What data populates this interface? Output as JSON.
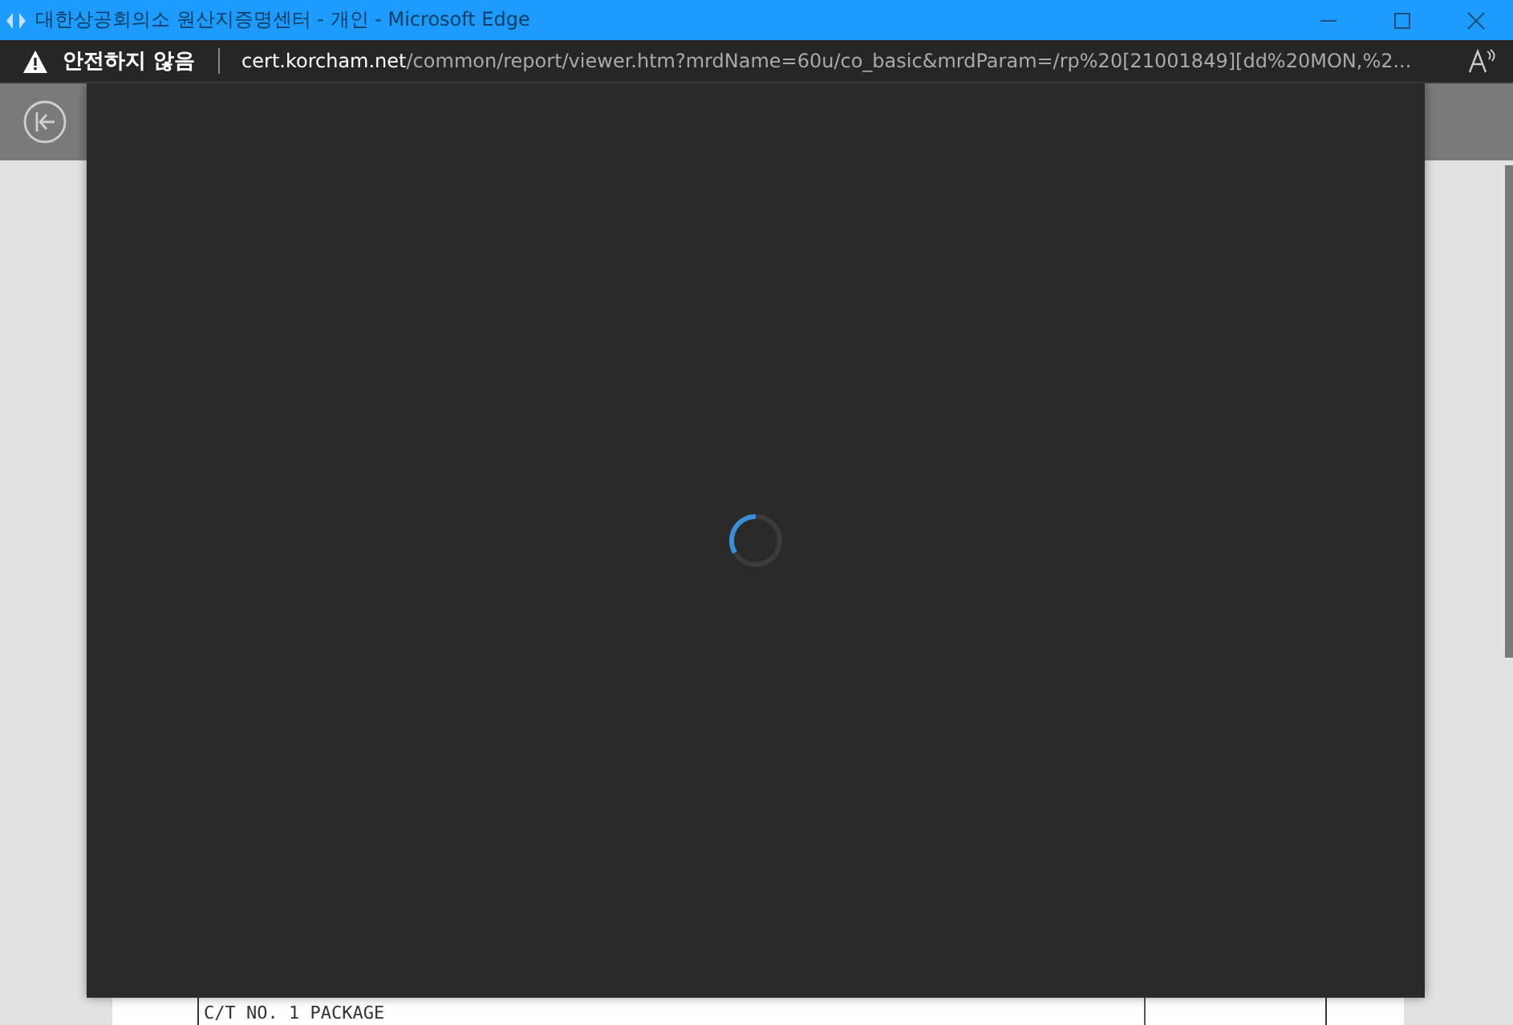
{
  "window": {
    "title": "대한상공회의소 원산지증명센터 - 개인 - Microsoft Edge"
  },
  "address_bar": {
    "security_label": "안전하지 않음",
    "url_host": "cert.korcham.net",
    "url_path": "/common/report/viewer.htm?mrdName=60u/co_basic&mrdParam=/rp%20[21001849][dd%20MON,%2..."
  },
  "document": {
    "line": "C/T NO.  1 PACKAGE"
  }
}
